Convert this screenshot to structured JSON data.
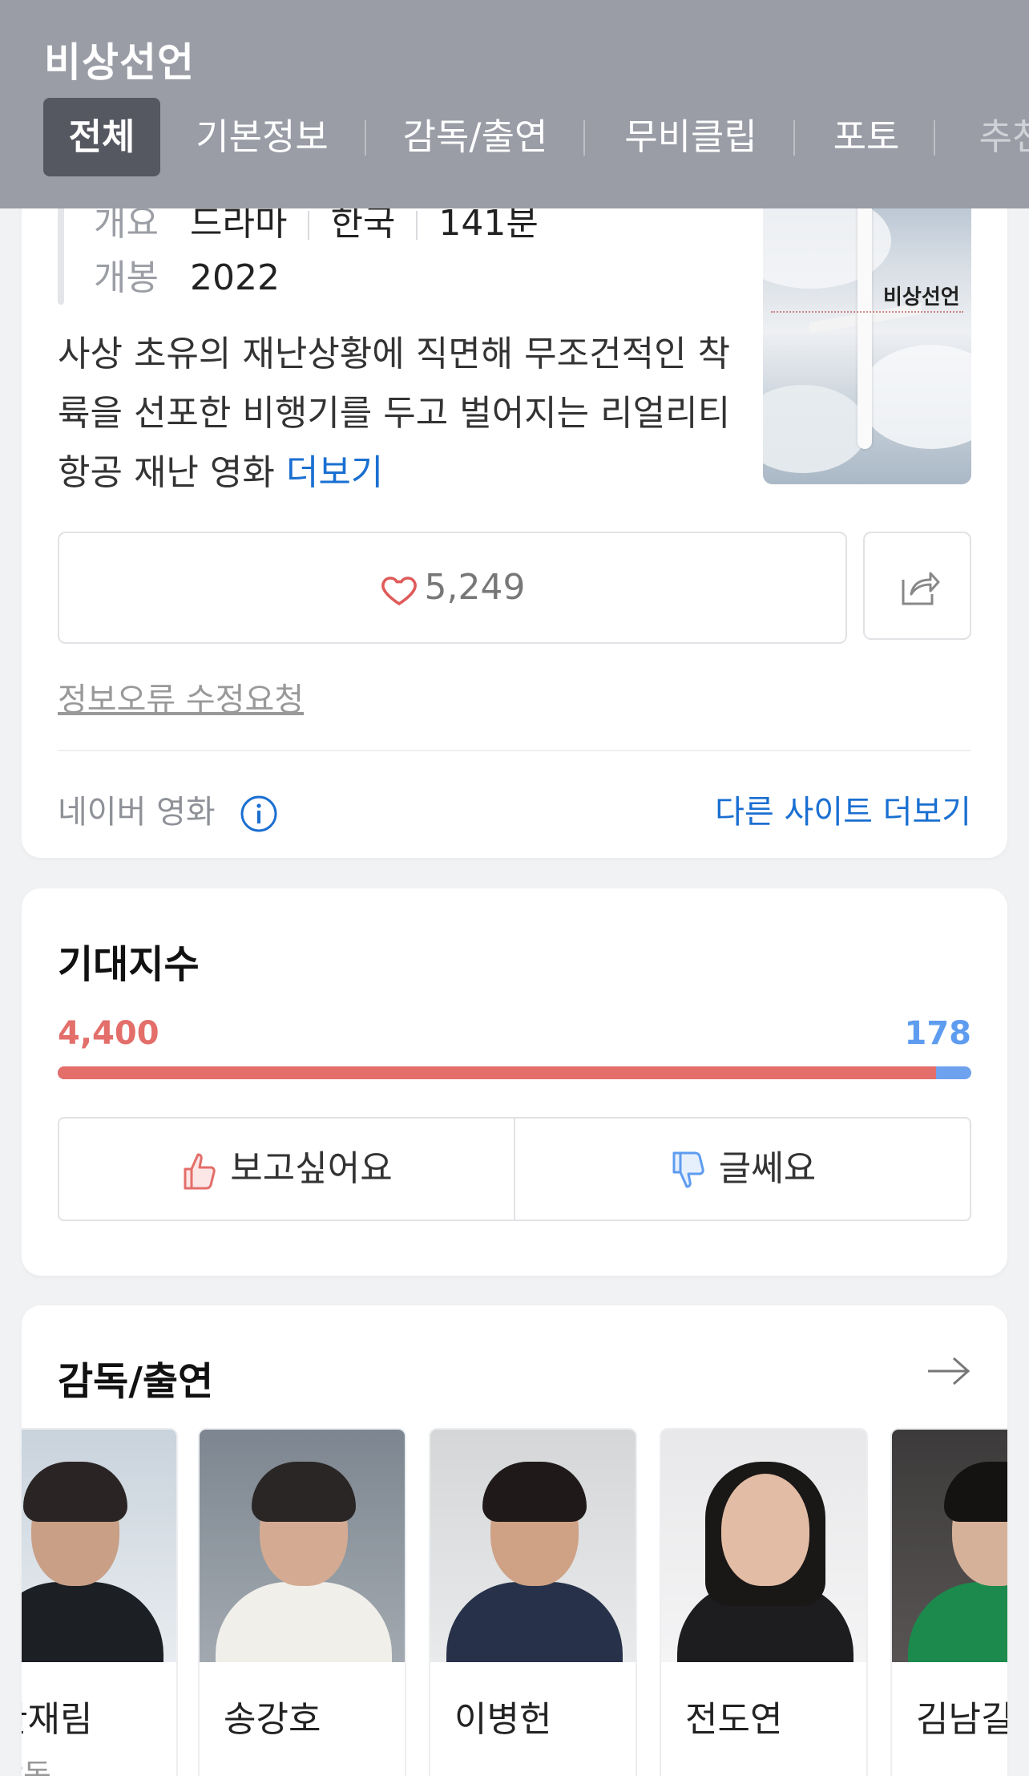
{
  "header": {
    "title": "비상선언",
    "tabs": [
      {
        "label": "전체",
        "active": true
      },
      {
        "label": "기본정보"
      },
      {
        "label": "감독/출연"
      },
      {
        "label": "무비클립"
      },
      {
        "label": "포토"
      },
      {
        "label": "추천"
      }
    ]
  },
  "info": {
    "overview_label": "개요",
    "genre": "드라마",
    "country": "한국",
    "runtime": "141분",
    "release_label": "개봉",
    "release_year": "2022",
    "description": "사상 초유의 재난상황에 직면해 무조건적인 착륙을 선포한 비행기를 두고 벌어지는 리얼리티 항공 재난 영화 ",
    "more_label": "더보기",
    "poster_title": "비상선언",
    "likes": "5,249",
    "report_label": "정보오류 수정요청",
    "source_label": "네이버 영화",
    "other_sites_label": "다른 사이트 더보기"
  },
  "expectation": {
    "title": "기대지수",
    "want_count": "4,400",
    "meh_count": "178",
    "want_ratio": 0.961,
    "want_label": "보고싶어요",
    "meh_label": "글쎄요",
    "colors": {
      "want": "#e36e6a",
      "meh": "#5e9cf0"
    }
  },
  "cast": {
    "title": "감독/출연",
    "people": [
      {
        "name": "한재림",
        "role": "감독"
      },
      {
        "name": "송강호",
        "role": ""
      },
      {
        "name": "이병헌",
        "role": ""
      },
      {
        "name": "전도연",
        "role": ""
      },
      {
        "name": "김남길",
        "role": ""
      }
    ]
  }
}
